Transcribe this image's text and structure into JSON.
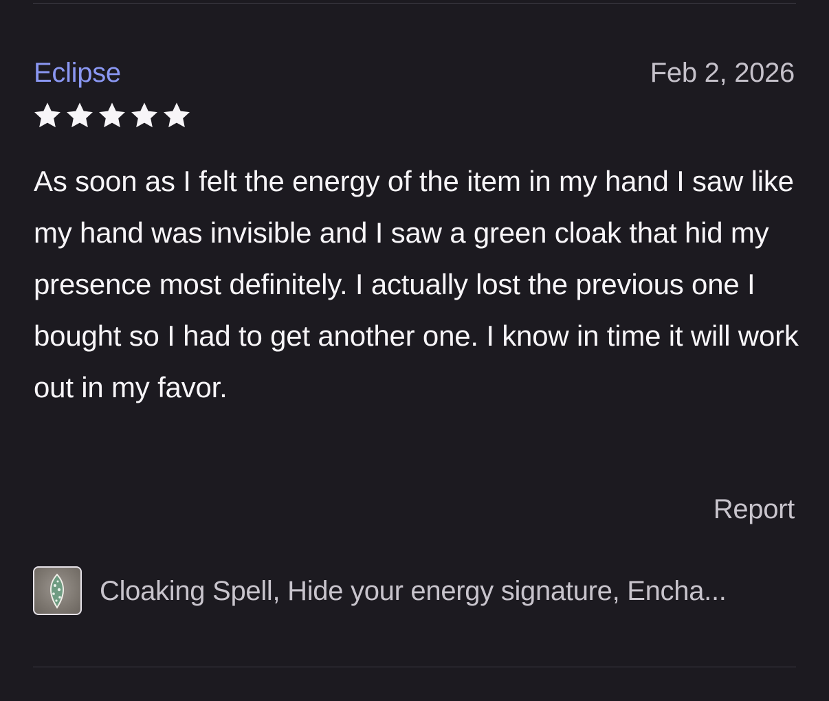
{
  "review": {
    "reviewer_name": "Eclipse",
    "date": "Feb 2, 2026",
    "rating": 5,
    "rating_max": 5,
    "text": "As soon as I felt the energy of the item in my hand I saw like my hand was invisible and I saw a green cloak that hid my presence most definitely. I actually lost the previous one I bought so I had to get another one. I know in time it will work out in my favor.",
    "report_label": "Report"
  },
  "product": {
    "title": "Cloaking Spell, Hide your energy signature, Encha..."
  },
  "colors": {
    "background": "#1c1a20",
    "reviewer_name": "#8a97f2",
    "secondary_text": "#c8c4cc",
    "star": "#f7f5f8"
  }
}
